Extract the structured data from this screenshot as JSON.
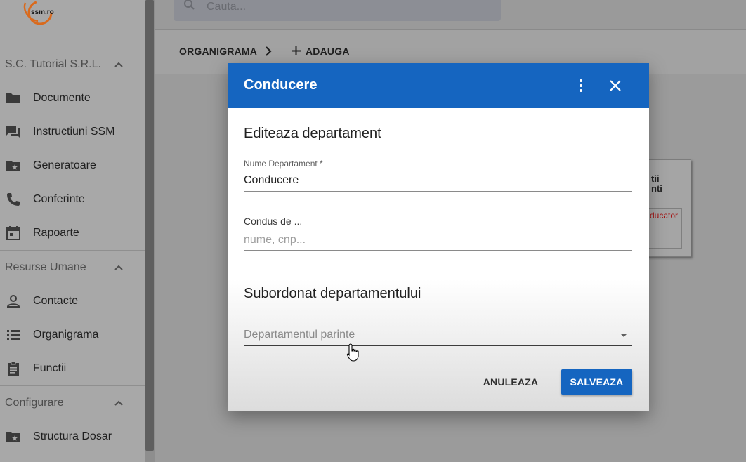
{
  "logo": {
    "text": "ssm.ro"
  },
  "search": {
    "placeholder": "Cauta..."
  },
  "sidebar": {
    "sections": [
      {
        "title": "S.C. Tutorial S.R.L.",
        "items": [
          {
            "label": "Documente",
            "icon": "folder-icon"
          },
          {
            "label": "Instructiuni SSM",
            "icon": "forum-icon"
          },
          {
            "label": "Generatoare",
            "icon": "folder-special-icon"
          },
          {
            "label": "Conferinte",
            "icon": "phone-icon"
          },
          {
            "label": "Rapoarte",
            "icon": "calendar-icon"
          }
        ]
      },
      {
        "title": "Resurse Umane",
        "items": [
          {
            "label": "Contacte",
            "icon": "person-icon"
          },
          {
            "label": "Organigrama",
            "icon": "list-icon"
          },
          {
            "label": "Functii",
            "icon": "assignment-icon"
          }
        ]
      },
      {
        "title": "Configurare",
        "items": [
          {
            "label": "Structura Dosar",
            "icon": "folder-special-icon"
          }
        ]
      }
    ]
  },
  "breadcrumb": {
    "root": "ORGANIGRAMA",
    "action": "ADAUGA"
  },
  "org_card": {
    "line1": "tii",
    "line2": "nti",
    "role": "ducator"
  },
  "dialog": {
    "title": "Conducere",
    "section1": "Editeaza departament",
    "name_label": "Nume Departament *",
    "name_value": "Conducere",
    "led_by_label": "Condus de ...",
    "led_by_placeholder": "nume, cnp...",
    "section2": "Subordonat departamentului",
    "parent_placeholder": "Departamentul parinte",
    "cancel": "ANULEAZA",
    "save": "SALVEAZA"
  },
  "colors": {
    "primary": "#1565c0",
    "red_text": "#a41313"
  }
}
